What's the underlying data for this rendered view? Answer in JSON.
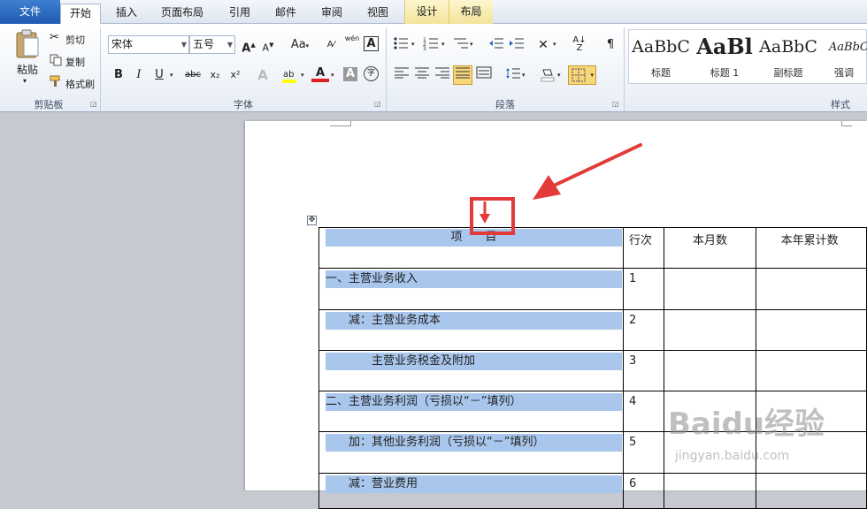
{
  "tabs": [
    "文件",
    "开始",
    "插入",
    "页面布局",
    "引用",
    "邮件",
    "审阅",
    "视图",
    "设计",
    "布局"
  ],
  "clipboard": {
    "paste": "粘贴",
    "cut": "剪切",
    "copy": "复制",
    "format_painter": "格式刷",
    "group": "剪贴板"
  },
  "font": {
    "name": "宋体",
    "size": "五号",
    "case_button": "Aa",
    "group": "字体",
    "bold": "B",
    "italic": "I",
    "underline": "U",
    "strike": "abc",
    "sub": "x₂",
    "sup": "x²",
    "font_color_glyph": "A",
    "char_shading_glyph": "A",
    "enclose_glyph": "字",
    "grow_glyph": "A",
    "shrink_glyph": "A",
    "phonetic_glyph": "wén",
    "border_glyph": "A"
  },
  "paragraph": {
    "group": "段落"
  },
  "styles": {
    "group": "样式",
    "items": [
      {
        "sample": "AaBbC",
        "name": "标题"
      },
      {
        "sample": "AaBl",
        "name": "标题 1"
      },
      {
        "sample": "AaBbC",
        "name": "副标题"
      },
      {
        "sample": "AaBbCc",
        "name": "强调"
      }
    ]
  },
  "table": {
    "header": {
      "item": "项　　目",
      "line": "行次",
      "month": "本月数",
      "year": "本年累计数"
    },
    "rows": [
      {
        "item": "一、主营业务收入",
        "line": "1"
      },
      {
        "item": "　　减：主营业务成本",
        "line": "2"
      },
      {
        "item": "　　　　主营业务税金及附加",
        "line": "3"
      },
      {
        "item": "二、主营业务利润（亏损以“－”填列）",
        "line": "4"
      },
      {
        "item": "　　加：其他业务利润（亏损以“－”填列）",
        "line": "5"
      },
      {
        "item": "　　减：营业费用",
        "line": "6"
      }
    ]
  },
  "watermark": {
    "brand": "Baidu经验",
    "url": "jingyan.baidu.com"
  },
  "colors": {
    "accent": "#e33a3a",
    "highlight": "#a9c6ec",
    "file_tab": "#2a66c0"
  }
}
